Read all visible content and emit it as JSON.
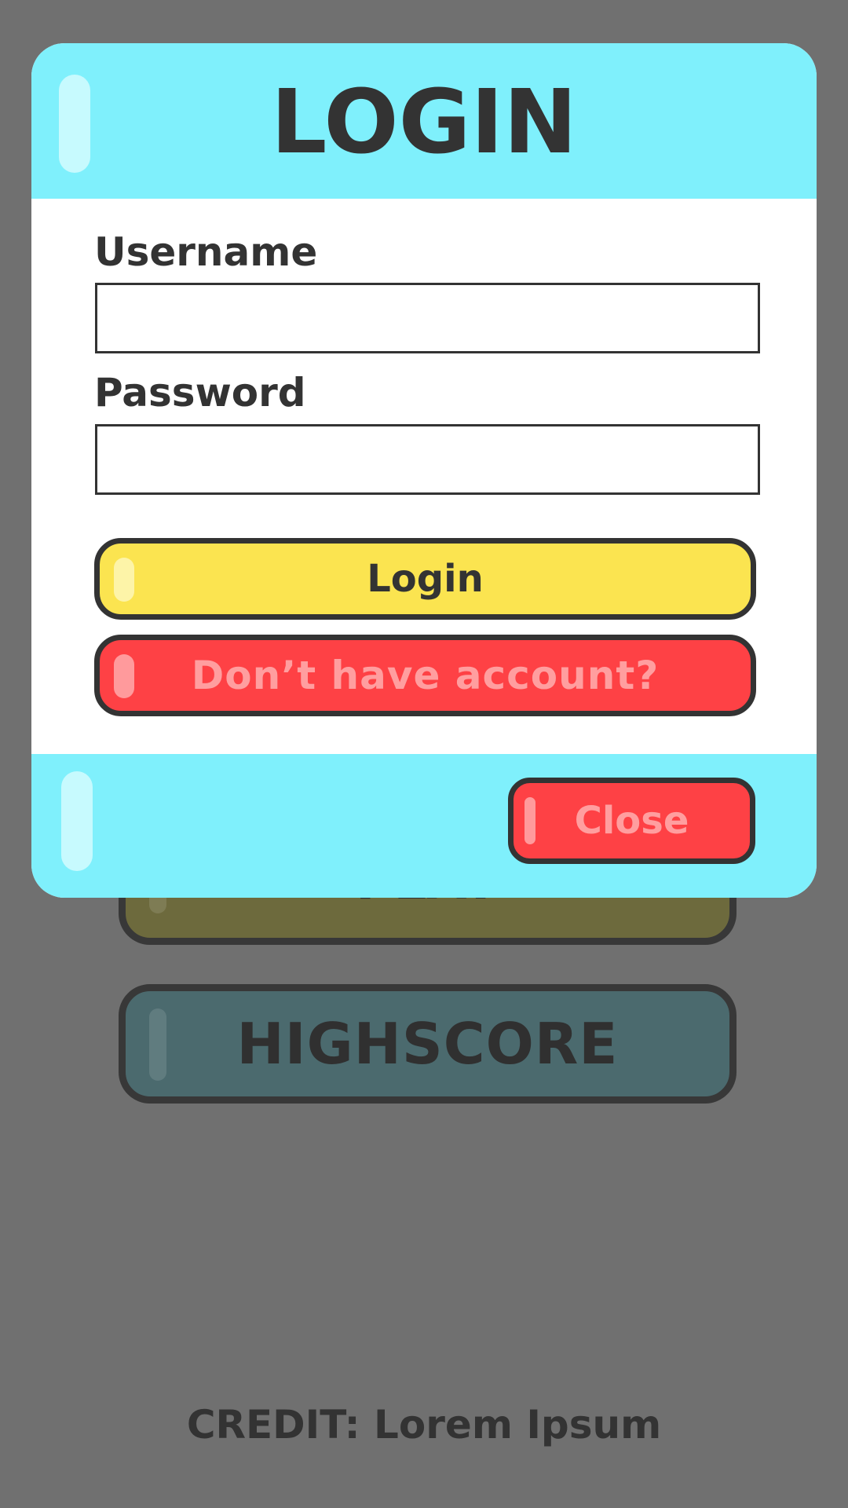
{
  "background_menu": {
    "play_label": "PLAY",
    "highscore_label": "HIGHSCORE",
    "credit": "CREDIT: Lorem Ipsum"
  },
  "login_dialog": {
    "title": "LOGIN",
    "username_label": "Username",
    "username_value": "",
    "password_label": "Password",
    "password_value": "",
    "login_button": "Login",
    "signup_button": "Don’t have account?",
    "close_button": "Close"
  },
  "colors": {
    "panel_cyan": "#7ff0fc",
    "login_yellow": "#fbe450",
    "danger_red": "#fe4145",
    "outline_dark": "#333333",
    "overlay_gray": "#707070"
  }
}
